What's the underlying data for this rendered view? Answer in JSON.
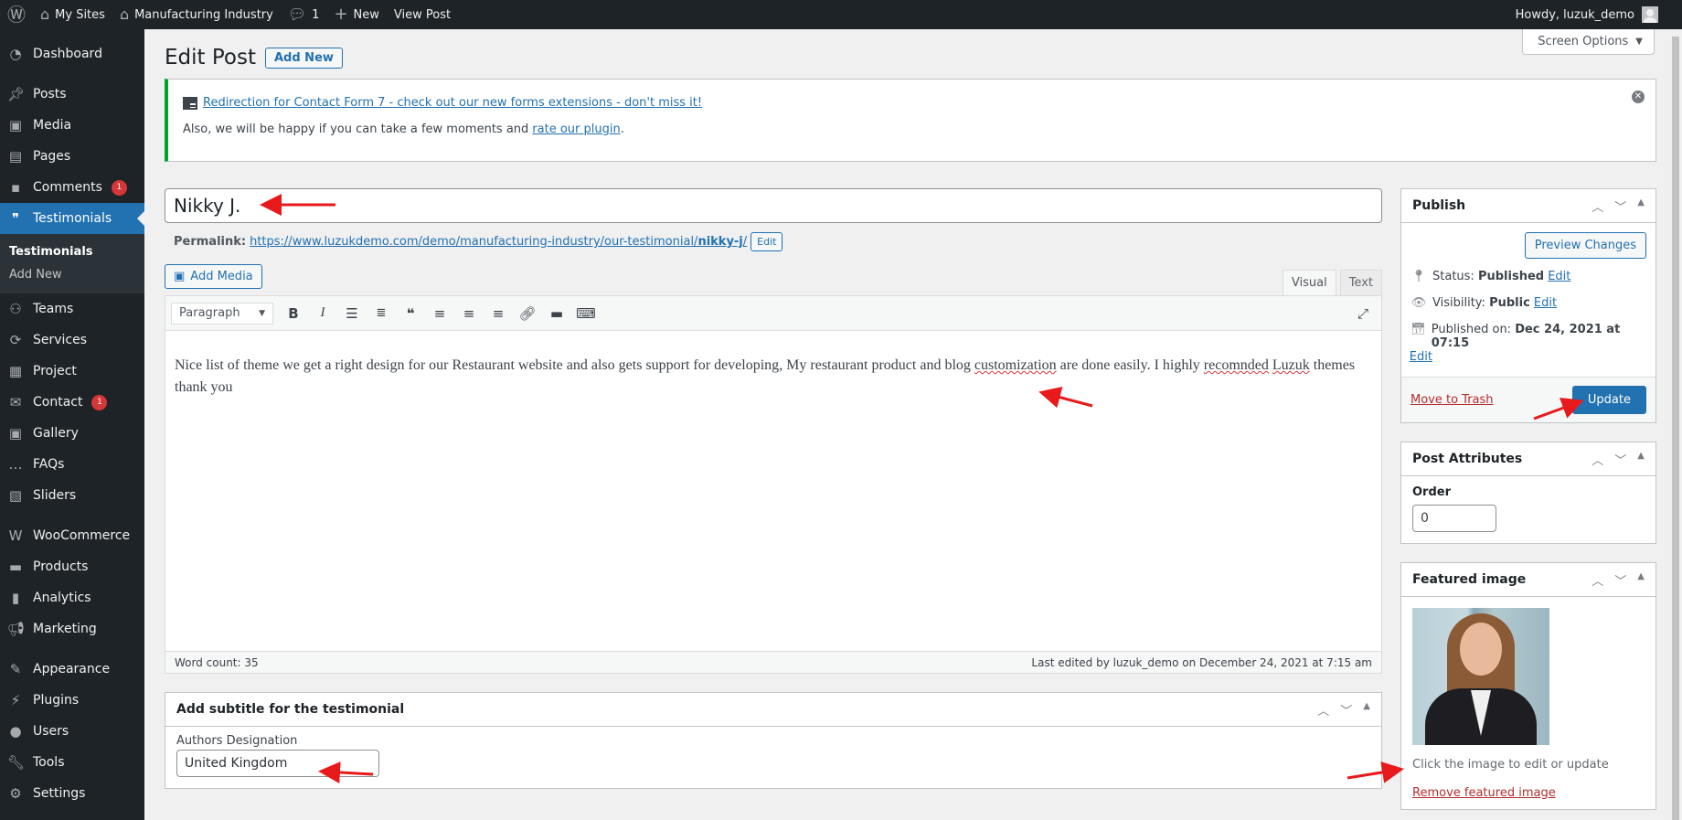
{
  "adminbar": {
    "wp_logo": "wordpress-logo",
    "my_sites": "My Sites",
    "site_name": "Manufacturing Industry",
    "comments_count": "1",
    "new_label": "New",
    "view_post": "View Post",
    "greeting": "Howdy, luzuk_demo"
  },
  "sidebar": {
    "items": [
      {
        "label": "Dashboard",
        "icon": "dashboard-icon"
      },
      {
        "label": "Posts",
        "icon": "pin-icon"
      },
      {
        "label": "Media",
        "icon": "media-icon"
      },
      {
        "label": "Pages",
        "icon": "pages-icon"
      },
      {
        "label": "Comments",
        "icon": "comment-icon",
        "badge": "1"
      },
      {
        "label": "Testimonials",
        "icon": "testimonial-icon",
        "active": true
      },
      {
        "label": "Teams",
        "icon": "groups-icon"
      },
      {
        "label": "Services",
        "icon": "update-icon"
      },
      {
        "label": "Project",
        "icon": "grid-icon"
      },
      {
        "label": "Contact",
        "icon": "email-icon",
        "badge": "1"
      },
      {
        "label": "Gallery",
        "icon": "media-icon"
      },
      {
        "label": "FAQs",
        "icon": "chat-bubble-icon"
      },
      {
        "label": "Sliders",
        "icon": "slides-icon"
      },
      {
        "label": "WooCommerce",
        "icon": "woo-icon"
      },
      {
        "label": "Products",
        "icon": "archive-icon"
      },
      {
        "label": "Analytics",
        "icon": "chart-icon"
      },
      {
        "label": "Marketing",
        "icon": "megaphone-icon"
      },
      {
        "label": "Appearance",
        "icon": "brush-icon"
      },
      {
        "label": "Plugins",
        "icon": "plugin-icon"
      },
      {
        "label": "Users",
        "icon": "user-icon"
      },
      {
        "label": "Tools",
        "icon": "wrench-icon"
      },
      {
        "label": "Settings",
        "icon": "settings-icon"
      }
    ],
    "submenu": [
      "Testimonials",
      "Add New"
    ]
  },
  "header": {
    "screen_options": "Screen Options",
    "title": "Edit Post",
    "add_new": "Add New"
  },
  "notice": {
    "link_text": "Redirection for Contact Form 7 - check out our new forms extensions - don't miss it!",
    "text_before": "Also, we will be happy if you can take a few moments and",
    "rate_link": "rate our plugin",
    "text_after": "."
  },
  "post": {
    "title": "Nikky J.",
    "permalink_label": "Permalink:",
    "permalink_base": "https://www.luzukdemo.com/demo/manufacturing-industry/our-testimonial/",
    "permalink_slug": "nikky-j",
    "permalink_end": "/",
    "permalink_edit": "Edit",
    "add_media": "Add Media",
    "tabs": [
      "Visual",
      "Text"
    ],
    "format": "Paragraph",
    "content_parts": [
      "Nice list of theme we get a right design for our Restaurant website and also gets support for developing, My restaurant product and blog ",
      "customization",
      " are done easily. I highly ",
      "recomnded",
      " ",
      "Luzuk",
      " themes thank you"
    ],
    "word_count": "Word count: 35",
    "last_edited": "Last edited by luzuk_demo on December 24, 2021 at 7:15 am"
  },
  "subtitle_box": {
    "title": "Add subtitle for the testimonial",
    "field_label": "Authors Designation",
    "field_value": "United Kingdom"
  },
  "publish": {
    "title": "Publish",
    "preview": "Preview Changes",
    "status_label": "Status:",
    "status_value": "Published",
    "visibility_label": "Visibility:",
    "visibility_value": "Public",
    "published_label": "Published on:",
    "published_value": "Dec 24, 2021 at 07:15",
    "edit": "Edit",
    "trash": "Move to Trash",
    "update": "Update"
  },
  "attributes": {
    "title": "Post Attributes",
    "order_label": "Order",
    "order_value": "0"
  },
  "featured": {
    "title": "Featured image",
    "note": "Click the image to edit or update",
    "remove": "Remove featured image"
  },
  "annotation_color": "#e8191b"
}
